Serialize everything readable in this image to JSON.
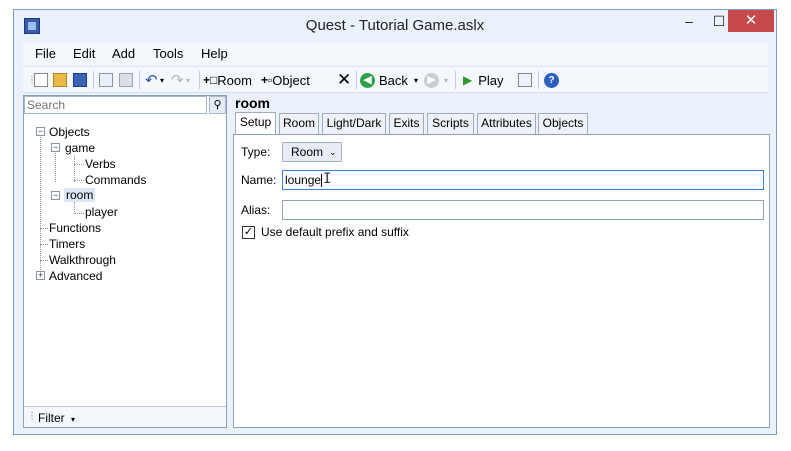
{
  "window": {
    "title": "Quest - Tutorial Game.aslx",
    "min": "–",
    "max": "☐",
    "close": "✕"
  },
  "menu": [
    "File",
    "Edit",
    "Add",
    "Tools",
    "Help"
  ],
  "toolbar": {
    "room_label": "Room",
    "object_label": "Object",
    "back_label": "Back",
    "play_label": "Play"
  },
  "search": {
    "placeholder": "Search",
    "value": ""
  },
  "tree": {
    "objects": "Objects",
    "game": "game",
    "verbs": "Verbs",
    "commands": "Commands",
    "room": "room",
    "player": "player",
    "functions": "Functions",
    "timers": "Timers",
    "walkthrough": "Walkthrough",
    "advanced": "Advanced"
  },
  "filter": {
    "label": "Filter"
  },
  "editor": {
    "object_name": "room",
    "tabs": [
      "Setup",
      "Room",
      "Light/Dark",
      "Exits",
      "Scripts",
      "Attributes",
      "Objects"
    ],
    "active_tab": "Setup",
    "type_label": "Type:",
    "type_value": "Room",
    "name_label": "Name:",
    "name_value": "lounge",
    "alias_label": "Alias:",
    "alias_value": "",
    "prefix_checkbox_label": "Use default prefix and suffix",
    "prefix_checked": true
  },
  "colors": {
    "accent": "#3c7fd8",
    "close": "#c74a4a",
    "play": "#2e9a2e",
    "back": "#2fa04a"
  }
}
